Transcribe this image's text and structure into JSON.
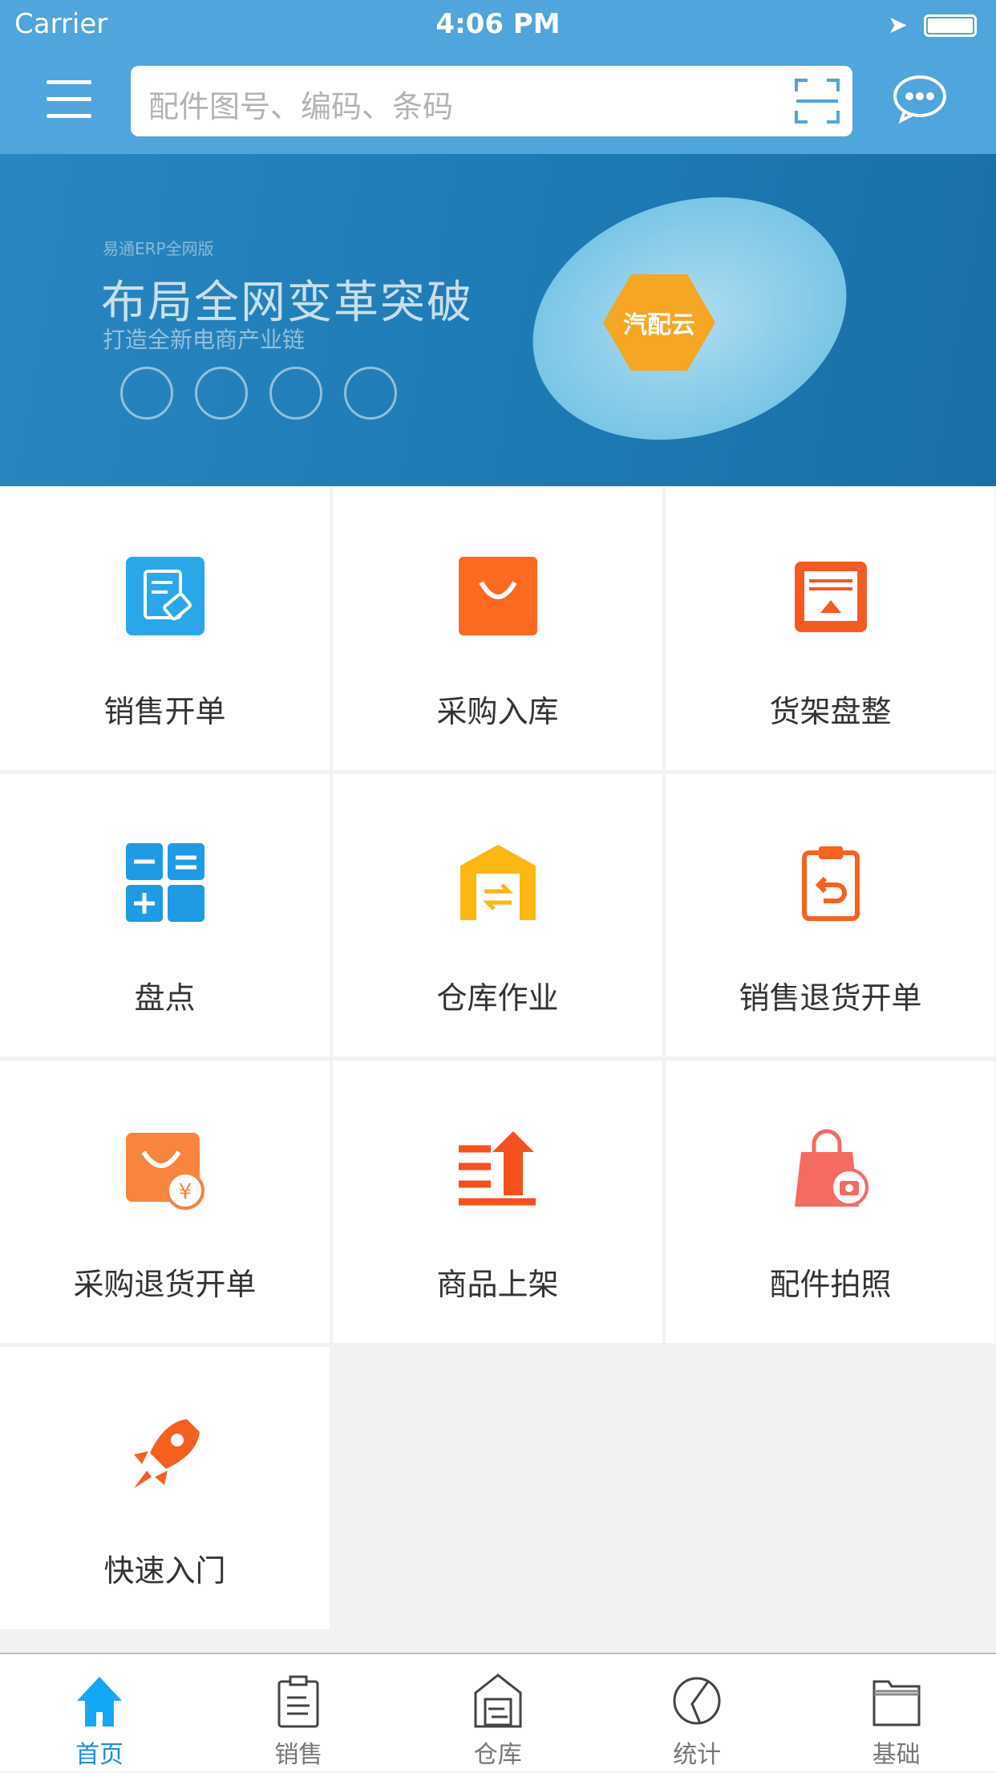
{
  "status_bar": {
    "carrier": "Carrier",
    "time": "4:06 PM"
  },
  "header": {
    "search_placeholder": "配件图号、编码、条码",
    "icons": [
      "menu-icon",
      "scan-icon",
      "chat-icon"
    ]
  },
  "banner": {
    "brand": "易通ERP全网版",
    "headline": "布局全网变革突破",
    "subline": "打造全新电商产业链",
    "center_label": "汽配云"
  },
  "grid": [
    {
      "label": "销售开单",
      "icon": "sales-order-icon",
      "color": "#29a7e8"
    },
    {
      "label": "采购入库",
      "icon": "shopping-bag-icon",
      "color": "#fb6a1e"
    },
    {
      "label": "货架盘整",
      "icon": "shelf-icon",
      "color": "#f45a24"
    },
    {
      "label": "盘点",
      "icon": "calculator-icon",
      "color": "#1e9be4"
    },
    {
      "label": "仓库作业",
      "icon": "warehouse-icon",
      "color": "#fdb713"
    },
    {
      "label": "销售退货开单",
      "icon": "return-clipboard-icon",
      "color": "#f5631f"
    },
    {
      "label": "采购退货开单",
      "icon": "bag-yen-icon",
      "color": "#f7853d"
    },
    {
      "label": "商品上架",
      "icon": "shelve-up-icon",
      "color": "#f4511e"
    },
    {
      "label": "配件拍照",
      "icon": "bag-camera-icon",
      "color": "#f56a62"
    },
    {
      "label": "快速入门",
      "icon": "rocket-icon",
      "color": "#f4611e"
    }
  ],
  "tabs": [
    {
      "label": "首页",
      "icon": "home-icon",
      "active": true
    },
    {
      "label": "销售",
      "icon": "clipboard-icon"
    },
    {
      "label": "仓库",
      "icon": "warehouse-icon"
    },
    {
      "label": "统计",
      "icon": "pie-chart-icon"
    },
    {
      "label": "基础",
      "icon": "folder-icon"
    }
  ],
  "colors": {
    "header": "#4fa5dc",
    "active_tab": "#1c8de0"
  }
}
